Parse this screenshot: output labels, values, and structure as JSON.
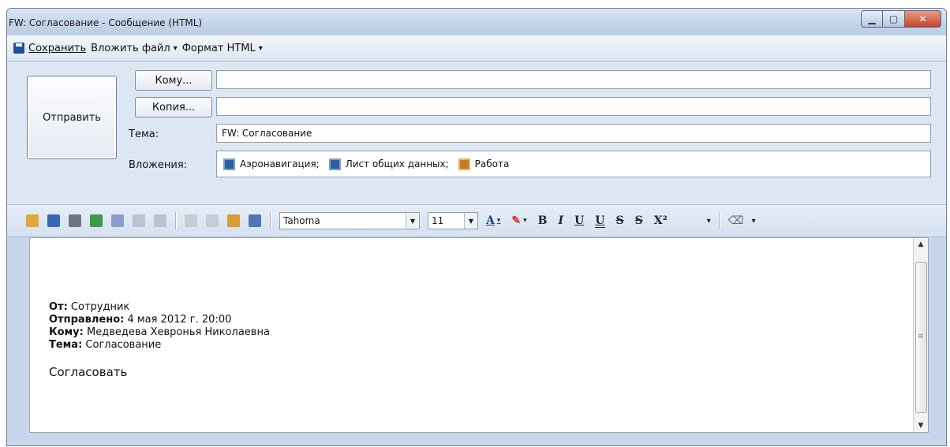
{
  "window": {
    "title": "FW: Согласование - Сообщение (HTML)"
  },
  "menu": {
    "save": "Сохранить",
    "attach": "Вложить файл",
    "format": "Формат HTML"
  },
  "header": {
    "send": "Отправить",
    "to_btn": "Кому...",
    "cc_btn": "Копия...",
    "to_value": "",
    "cc_value": "",
    "subject_label": "Тема:",
    "subject_value": "FW: Согласование",
    "attachments_label": "Вложения:",
    "attachments": [
      {
        "name": "Аэронавигация;",
        "icon": "document-icon"
      },
      {
        "name": "Лист общих данных;",
        "icon": "document-icon"
      },
      {
        "name": "Работа",
        "icon": "clipboard-icon"
      }
    ]
  },
  "toolbar": {
    "font_name": "Tahoma",
    "font_size": "11",
    "bold": "B",
    "italic": "I",
    "underline": "U",
    "double_underline": "U",
    "strike": "S",
    "double_strike": "S",
    "superscript": "X²"
  },
  "body": {
    "from_label": "От:",
    "from_value": " Сотрудник",
    "sent_label": "Отправлено:",
    "sent_value": " 4 мая 2012 г. 20:00",
    "to_label": "Кому:",
    "to_value": " Медведева Хевронья Николаевна",
    "subject_label": "Тема:",
    "subject_value": " Согласование",
    "message": "Согласовать"
  },
  "colors": {
    "window_frame": "#c7d6ea",
    "close_button": "#c74329"
  }
}
